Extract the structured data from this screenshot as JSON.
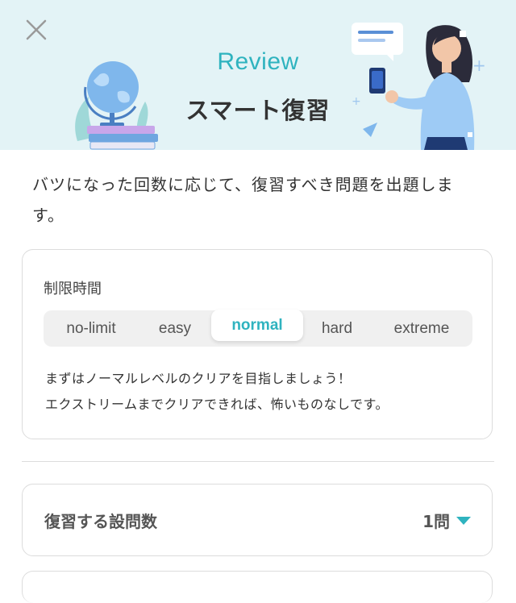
{
  "header": {
    "subtitle": "Review",
    "title": "スマート復習"
  },
  "description": "バツになった回数に応じて、復習すべき問題を出題します。",
  "time_limit": {
    "label": "制限時間",
    "options": [
      "no-limit",
      "easy",
      "normal",
      "hard",
      "extreme"
    ],
    "selected": "normal",
    "note_line1": "まずはノーマルレベルのクリアを目指しましょう！",
    "note_line2": "エクストリームまでクリアできれば、怖いものなしです。"
  },
  "question_count": {
    "label": "復習する設問数",
    "value": "1問"
  },
  "colors": {
    "accent": "#2fb3bf",
    "hero_bg": "#e3f3f6",
    "text": "#333333"
  }
}
